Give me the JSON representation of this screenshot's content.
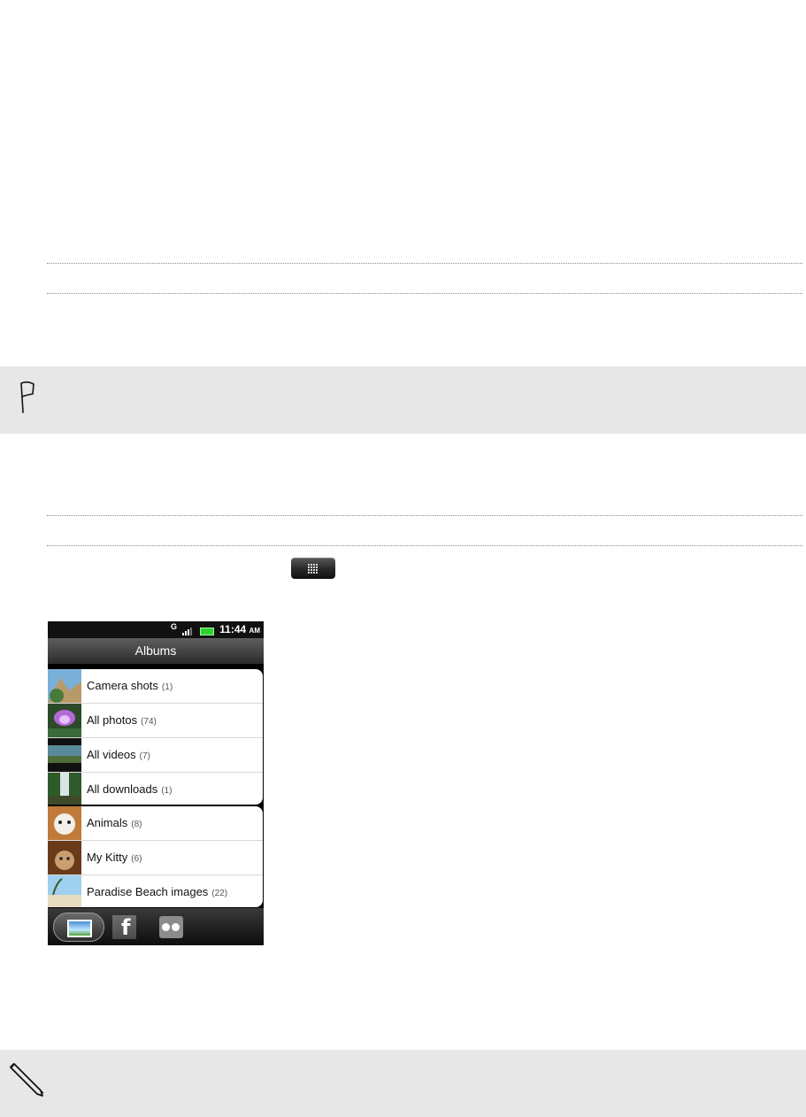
{
  "phone": {
    "status_time": "11:44",
    "status_ampm": "AM",
    "network": "G",
    "title": "Albums",
    "albums": [
      {
        "name": "Camera shots",
        "count": "(1)"
      },
      {
        "name": "All photos",
        "count": "(74)"
      },
      {
        "name": "All videos",
        "count": "(7)"
      },
      {
        "name": "All downloads",
        "count": "(1)"
      },
      {
        "name": "Animals",
        "count": "(8)"
      },
      {
        "name": "My Kitty",
        "count": "(6)"
      },
      {
        "name": "Paradise Beach images",
        "count": "(22)"
      }
    ]
  },
  "icons": {
    "flag": "flag-icon",
    "pencil": "pencil-icon",
    "menu_grid": "grid-menu-icon",
    "tabs": [
      "gallery-tab-icon",
      "facebook-tab-icon",
      "flickr-tab-icon"
    ]
  },
  "colors": {
    "callout_band": "#e7e7e7",
    "battery": "#2fcf2f"
  }
}
